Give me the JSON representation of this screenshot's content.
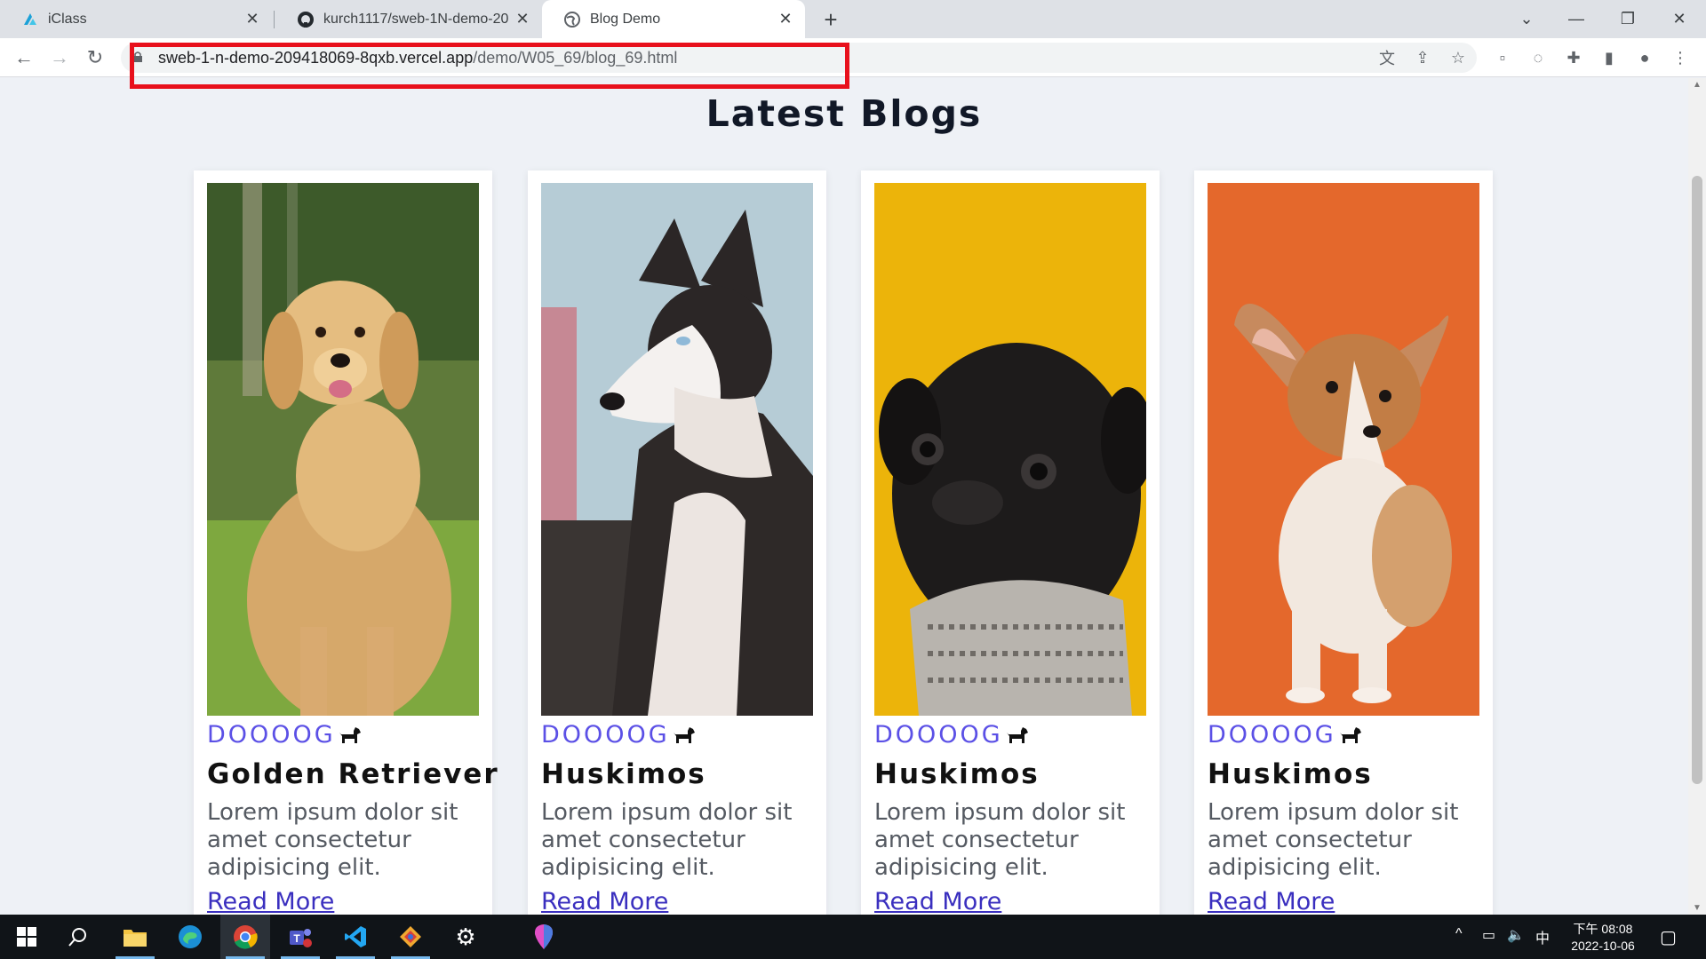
{
  "browser": {
    "tabs": [
      {
        "title": "iClass",
        "icon": "iclass-icon"
      },
      {
        "title": "kurch1117/sweb-1N-demo-20",
        "icon": "github-icon"
      },
      {
        "title": "Blog Demo",
        "icon": "globe-icon",
        "active": true
      }
    ],
    "url_host": "sweb-1-n-demo-209418069-8qxb.vercel.app",
    "url_path": "/demo/W05_69/blog_69.html",
    "highlight_color": "#e8101c"
  },
  "page": {
    "title": "Latest Blogs",
    "cards": [
      {
        "tag": "DOOOOG",
        "title": "Golden Retriever",
        "description": "Lorem ipsum dolor sit amet consectetur adipisicing elit.",
        "link": "Read More",
        "image": "golden-retriever-photo"
      },
      {
        "tag": "DOOOOG",
        "title": "Huskimos",
        "description": "Lorem ipsum dolor sit amet consectetur adipisicing elit.",
        "link": "Read More",
        "image": "husky-photo"
      },
      {
        "tag": "DOOOOG",
        "title": "Huskimos",
        "description": "Lorem ipsum dolor sit amet consectetur adipisicing elit.",
        "link": "Read More",
        "image": "pug-photo"
      },
      {
        "tag": "DOOOOG",
        "title": "Huskimos",
        "description": "Lorem ipsum dolor sit amet consectetur adipisicing elit.",
        "link": "Read More",
        "image": "corgi-puppy-photo"
      }
    ],
    "colors": {
      "tag": "#5b50e6",
      "link": "#3a2fbf",
      "background": "#eef1f6"
    }
  },
  "taskbar": {
    "time": "下午 08:08",
    "date": "2022-10-06",
    "ime": "中",
    "apps": [
      "start",
      "search",
      "file-explorer",
      "edge",
      "chrome",
      "teams",
      "vscode",
      "git",
      "settings",
      "maps"
    ]
  }
}
